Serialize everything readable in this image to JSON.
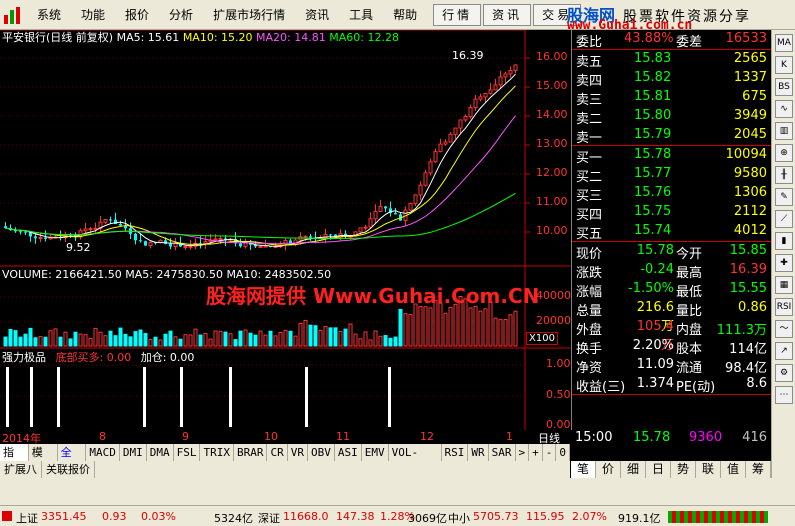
{
  "menu": {
    "items": [
      "系统",
      "功能",
      "报价",
      "分析",
      "扩展市场行情",
      "资讯",
      "工具",
      "帮助"
    ],
    "tabs": [
      "行情",
      "资讯",
      "交易"
    ]
  },
  "brand": {
    "name": "股海网",
    "tagline": "股票软件资源分享",
    "url": "www.Guhai.com.cn"
  },
  "chart": {
    "title": "平安银行(日线 前复权)",
    "ma5": "MA5: 15.61",
    "ma10": "MA10: 15.20",
    "ma20": "MA20: 14.81",
    "ma60": "MA60: 12.28",
    "high_label": "16.39",
    "low_label": "9.52",
    "price_ticks": [
      "16.00",
      "15.00",
      "14.00",
      "13.00",
      "12.00",
      "11.00",
      "10.00"
    ],
    "volume_legend": "VOLUME: 2166421.50  MA5: 2475830.50  MA10: 2483502.50",
    "vol_ticks": [
      "40000",
      "20000"
    ],
    "vol_unit": "X100",
    "indicator_name": "强力极品",
    "indicator_line1": "底部买多: 0.00",
    "indicator_line2": "加仓: 0.00",
    "ind_ticks": [
      "1.00",
      "0.50",
      "0.00"
    ],
    "watermark": "股海网提供 Www.Guhai.Com.CN",
    "date_labels": [
      "2014年",
      "8",
      "9",
      "10",
      "11",
      "12",
      "1"
    ],
    "period_label": "日线"
  },
  "quote": {
    "weibi_label": "委比",
    "weibi_value": "43.88%",
    "weicha_label": "委差",
    "weicha_value": "16533",
    "sells": [
      {
        "label": "卖五",
        "price": "15.83",
        "vol": "2565"
      },
      {
        "label": "卖四",
        "price": "15.82",
        "vol": "1337"
      },
      {
        "label": "卖三",
        "price": "15.81",
        "vol": "675"
      },
      {
        "label": "卖二",
        "price": "15.80",
        "vol": "3949"
      },
      {
        "label": "卖一",
        "price": "15.79",
        "vol": "2045"
      }
    ],
    "buys": [
      {
        "label": "买一",
        "price": "15.78",
        "vol": "10094"
      },
      {
        "label": "买二",
        "price": "15.77",
        "vol": "9580"
      },
      {
        "label": "买三",
        "price": "15.76",
        "vol": "1306"
      },
      {
        "label": "买四",
        "price": "15.75",
        "vol": "2112"
      },
      {
        "label": "买五",
        "price": "15.74",
        "vol": "4012"
      }
    ],
    "stats": [
      {
        "a": "现价",
        "b": "15.78",
        "c": "今开",
        "d": "15.85"
      },
      {
        "a": "涨跌",
        "b": "-0.24",
        "c": "最高",
        "d": "16.39"
      },
      {
        "a": "涨幅",
        "b": "-1.50%",
        "c": "最低",
        "d": "15.55"
      },
      {
        "a": "总量",
        "b": "216.6万",
        "c": "量比",
        "d": "0.86"
      },
      {
        "a": "外盘",
        "b": "105.4万",
        "c": "内盘",
        "d": "111.3万"
      },
      {
        "a": "换手",
        "b": "2.20%",
        "c": "股本",
        "d": "114亿"
      },
      {
        "a": "净资",
        "b": "11.09",
        "c": "流通",
        "d": "98.4亿"
      },
      {
        "a": "收益(三)",
        "b": "1.374",
        "c": "PE(动)",
        "d": "8.6"
      }
    ],
    "tick_time": "15:00",
    "tick_price": "15.78",
    "tick_vol": "9360",
    "tick_extra": "416"
  },
  "indicator_tabs": [
    "指标",
    "模板",
    "全部",
    "MACD",
    "DMI",
    "DMA",
    "FSL",
    "TRIX",
    "BRAR",
    "CR",
    "VR",
    "OBV",
    "ASI",
    "EMV",
    "VOL-TDX",
    "RSI",
    "WR",
    "SAR",
    ">",
    "+",
    "-",
    "0"
  ],
  "bottom_tabs": [
    "扩展八",
    "关联报价"
  ],
  "panel_tabs": [
    "笔",
    "价",
    "细",
    "日",
    "势",
    "联",
    "值",
    "筹"
  ],
  "sidebar_icons": [
    "MA",
    "K",
    "BS",
    "RSI"
  ],
  "status": {
    "sh_label": "上证",
    "sh_val": "3351.45",
    "sh_chg": "0.93",
    "sh_pct": "0.03%",
    "sh_amt": "5324亿",
    "sz_label": "深证",
    "sz_val": "11668.0",
    "sz_chg": "147.38",
    "sz_pct": "1.28%",
    "sz_amt": "3069亿",
    "zx_label": "中小",
    "zx_val": "5705.73",
    "zx_chg": "115.95",
    "zx_pct": "2.07%",
    "zx_amt": "919.1亿"
  }
}
